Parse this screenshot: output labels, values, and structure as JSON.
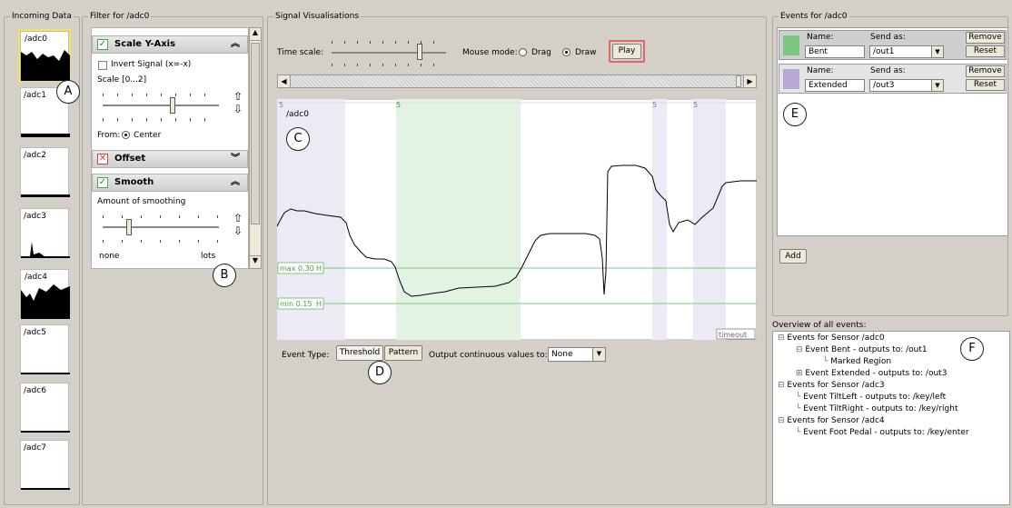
{
  "incoming": {
    "title": "Incoming Data",
    "sensors": [
      "/adc0",
      "/adc1",
      "/adc2",
      "/adc3",
      "/adc4",
      "/adc5",
      "/adc6",
      "/adc7"
    ]
  },
  "filter": {
    "title": "Filter for /adc0",
    "scale_y": {
      "heading": "Scale Y-Axis",
      "invert_label": "Invert Signal (x=-x)",
      "scale_label": "Scale [0...2]",
      "from_label": "From:",
      "center_label": "Center"
    },
    "offset": {
      "heading": "Offset"
    },
    "smooth": {
      "heading": "Smooth",
      "amount_label": "Amount of smoothing",
      "min_label": "none",
      "max_label": "lots"
    }
  },
  "signal": {
    "title": "Signal Visualisations",
    "time_scale_label": "Time scale:",
    "mouse_mode_label": "Mouse mode:",
    "drag_label": "Drag",
    "draw_label": "Draw",
    "play_label": "Play",
    "sensor_label": "/adc0",
    "max_label": "max 0.30",
    "min_label": "min 0.15",
    "h_label": "H",
    "timeout_label": "timeout",
    "marker_label": "5",
    "event_type_label": "Event Type:",
    "threshold_label": "Threshold",
    "pattern_label": "Pattern",
    "output_label": "Output continuous values to:",
    "output_value": "None"
  },
  "events": {
    "title": "Events for /adc0",
    "name_label": "Name:",
    "send_label": "Send as:",
    "remove_label": "Remove",
    "reset_label": "Reset",
    "add_label": "Add",
    "items": [
      {
        "name": "Bent",
        "send": "/out1",
        "color": "#7fc77f"
      },
      {
        "name": "Extended",
        "send": "/out3",
        "color": "#b8a8d8"
      }
    ]
  },
  "overview": {
    "title": "Overview of all events:",
    "lines": [
      "Events for Sensor /adc0",
      "Event Bent - outputs to: /out1",
      "Marked Region",
      "Event Extended - outputs to: /out3",
      "Events for Sensor /adc3",
      "Event TiltLeft - outputs to: /key/left",
      "Event TiltRight - outputs to: /key/right",
      "Events for Sensor /adc4",
      "Event Foot Pedal - outputs to: /key/enter"
    ]
  },
  "annotations": [
    "A",
    "B",
    "C",
    "D",
    "E",
    "F"
  ],
  "colors": {
    "highlight": "#f5e35a",
    "bent": "#7fc77f",
    "extended": "#b8a8d8",
    "play_border": "#e06666",
    "threshold_line": "#7fc77f"
  }
}
